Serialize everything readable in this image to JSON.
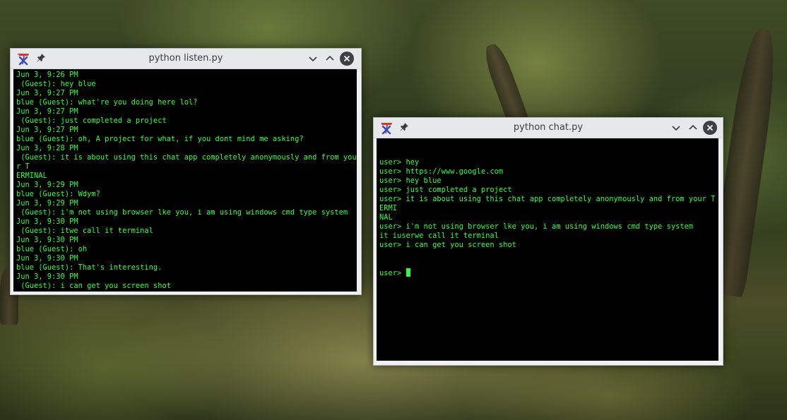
{
  "windows": {
    "listen": {
      "title": "python listen.py",
      "lines": [
        "Jun 3, 9:26 PM",
        " (Guest): hey blue",
        "Jun 3, 9:27 PM",
        "blue (Guest): what're you doing here lol?",
        "Jun 3, 9:27 PM",
        " (Guest): just completed a project",
        "Jun 3, 9:27 PM",
        "blue (Guest): oh, A project for what, if you dont mind me asking?",
        "Jun 3, 9:28 PM",
        " (Guest): it is about using this chat app completely anonymously and from your T",
        "ERMINAL",
        "Jun 3, 9:29 PM",
        "blue (Guest): Wdym?",
        "Jun 3, 9:29 PM",
        " (Guest): i'm not using browser lke you, i am using windows cmd type system",
        "Jun 3, 9:30 PM",
        " (Guest): itwe call it terminal",
        "Jun 3, 9:30 PM",
        "blue (Guest): oh",
        "Jun 3, 9:30 PM",
        "blue (Guest): That's interesting.",
        "Jun 3, 9:30 PM",
        " (Guest): i can get you screen shot"
      ]
    },
    "chat": {
      "title": "python chat.py",
      "lines": [
        "user> hey",
        "user> https://www.google.com",
        "user> hey blue",
        "user> just completed a project",
        "user> it is about using this chat app completely anonymously and from your TERMI",
        "NAL",
        "user> i'm not using browser lke you, i am using windows cmd type system",
        "it iuserwe call it terminal",
        "user> i can get you screen shot"
      ],
      "prompt": "user> "
    }
  },
  "colors": {
    "terminal_text": "#2bff3d",
    "terminal_bg": "#000000",
    "titlebar_bg": "#e6e8ea"
  },
  "icons": {
    "app": "tk-feather-icon",
    "pin": "pin-icon",
    "minimize": "chevron-down-icon",
    "maximize": "chevron-up-icon",
    "close": "close-icon"
  }
}
